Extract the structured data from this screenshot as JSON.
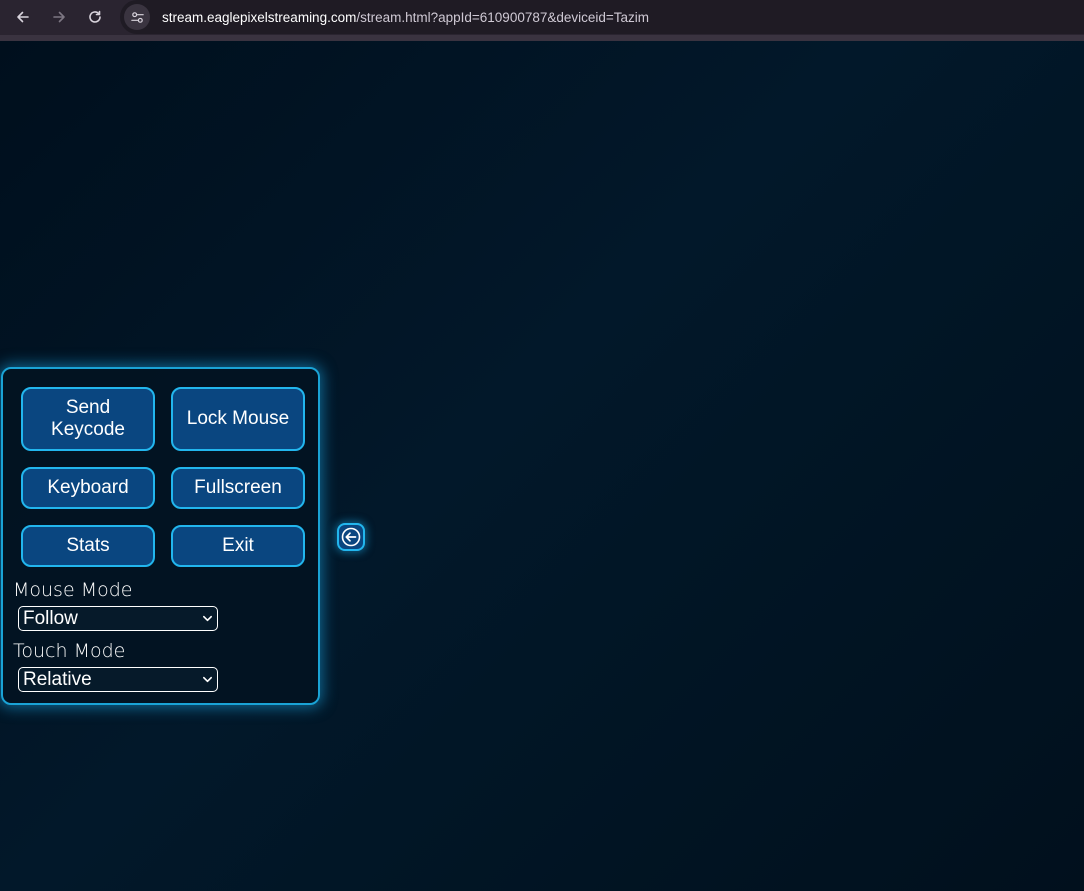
{
  "browser": {
    "url_host": "stream.eaglepixelstreaming.com",
    "url_path": "/stream.html?appId=610900787&deviceid=Tazim"
  },
  "panel": {
    "send_keycode_line1": "Send",
    "send_keycode_line2": "Keycode",
    "lock_mouse": "Lock Mouse",
    "keyboard": "Keyboard",
    "fullscreen": "Fullscreen",
    "stats": "Stats",
    "exit": "Exit",
    "mouse_mode_label": "Mouse Mode",
    "mouse_mode_value": "Follow",
    "touch_mode_label": "Touch Mode",
    "touch_mode_value": "Relative"
  },
  "colors": {
    "accent": "#22b6ee",
    "button_bg": "#0a4680",
    "background": "#01111f"
  },
  "icons": {
    "back": "back-arrow-icon",
    "forward": "forward-arrow-icon",
    "reload": "reload-icon",
    "site_info": "site-settings-icon",
    "collapse": "arrow-left-circle-icon"
  }
}
